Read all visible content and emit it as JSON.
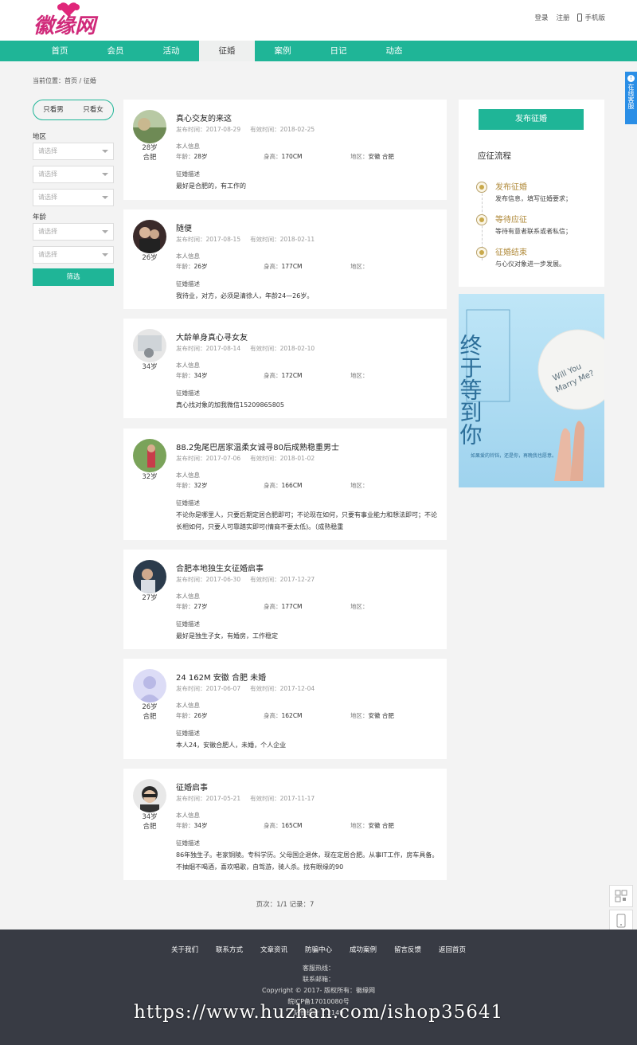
{
  "header": {
    "logo_text": "徽缘网",
    "login": "登录",
    "register": "注册",
    "mobile": "手机版"
  },
  "nav": [
    {
      "label": "首页"
    },
    {
      "label": "会员"
    },
    {
      "label": "活动"
    },
    {
      "label": "征婚",
      "active": true
    },
    {
      "label": "案例"
    },
    {
      "label": "日记"
    },
    {
      "label": "动态"
    }
  ],
  "breadcrumb": "当前位置：首页 / 征婚",
  "sidebar": {
    "only_male": "只看男",
    "only_female": "只看女",
    "region_label": "地区",
    "age_label": "年龄",
    "placeholder": "请选择",
    "filter_button": "筛选"
  },
  "posts_labels": {
    "publish_time": "发布时间：",
    "valid_time": "有效时间：",
    "personal_info": "本人信息",
    "age": "年龄：",
    "height": "身高：",
    "region": "地区：",
    "desc_title": "征婚描述"
  },
  "posts": [
    {
      "title": "真心交友的来这",
      "pub": "2017-08-29",
      "valid": "2018-02-25",
      "age_short": "28岁",
      "city": "合肥",
      "age": "28岁",
      "height": "170CM",
      "region": "安徽 合肥",
      "desc": "最好是合肥的，有工作的"
    },
    {
      "title": "随便",
      "pub": "2017-08-15",
      "valid": "2018-02-11",
      "age_short": "26岁",
      "city": "",
      "age": "26岁",
      "height": "177CM",
      "region": "",
      "desc": "我待业，对方，必须是清徐人，年龄24—26岁。"
    },
    {
      "title": "大龄单身真心寻女友",
      "pub": "2017-08-14",
      "valid": "2018-02-10",
      "age_short": "34岁",
      "city": "",
      "age": "34岁",
      "height": "172CM",
      "region": "",
      "desc": "真心找对象的加我微信15209865805"
    },
    {
      "title": "88.2兔尾巴居家温柔女诚寻80后成熟稳重男士",
      "pub": "2017-07-06",
      "valid": "2018-01-02",
      "age_short": "32岁",
      "city": "",
      "age": "32岁",
      "height": "166CM",
      "region": "",
      "desc": "不论你是哪里人，只要后期定居合肥即可；不论现在如何，只要有事业能力和想法即可；不论长相如何，只要人可靠踏实即可(情商不要太低)。（成熟稳重"
    },
    {
      "title": "合肥本地独生女征婚启事",
      "pub": "2017-06-30",
      "valid": "2017-12-27",
      "age_short": "27岁",
      "city": "",
      "age": "27岁",
      "height": "177CM",
      "region": "",
      "desc": "最好是独生子女，有婚房，工作稳定"
    },
    {
      "title": "24 162M 安徽 合肥 未婚",
      "pub": "2017-06-07",
      "valid": "2017-12-04",
      "age_short": "26岁",
      "city": "合肥",
      "age": "26岁",
      "height": "162CM",
      "region": "安徽 合肥",
      "desc": "本人24，安徽合肥人，未婚，个人企业"
    },
    {
      "title": "征婚启事",
      "pub": "2017-05-21",
      "valid": "2017-11-17",
      "age_short": "34岁",
      "city": "合肥",
      "age": "34岁",
      "height": "165CM",
      "region": "安徽 合肥",
      "desc": "86年独生子。老家铜陵。专科学历。父母国企退休，现在定居合肥。从事IT工作，房车具备。不抽烟不喝酒，喜欢唱歌，自驾游，骑人杀。找有眼缘的90"
    }
  ],
  "pager": "页次：1/1  记录：7",
  "right_panel": {
    "publish_button": "发布征婚",
    "flow_title": "应征流程",
    "steps": [
      {
        "title": "发布征婚",
        "desc": "发布信息，填写征婚要求；"
      },
      {
        "title": "等待应征",
        "desc": "等待有意者联系或者私信；"
      },
      {
        "title": "征婚结束",
        "desc": "与心仪对象进一步发展。"
      }
    ]
  },
  "banner": {
    "big_text": "终于等到你",
    "balloon_line1": "Will You",
    "balloon_line2": "Marry Me?",
    "small_text": "如果爱的铃铛，还是你，再晚我也愿意。"
  },
  "side_tab": "在线客服",
  "footer": {
    "links": [
      "关于我们",
      "联系方式",
      "文章资讯",
      "防骗中心",
      "成功案例",
      "留言反馈",
      "返回首页"
    ],
    "hotline": "客服热线：",
    "email": "联系邮箱：",
    "copyright": "Copyright © 2017-  版权所有：徽缘网",
    "icp": "皖ICP备17010080号",
    "stats": "站长统计  1  2149"
  },
  "watermark": "https://www.huzhan.com/ishop35641",
  "colors": {
    "primary": "#1fb597",
    "footer_bg": "#383b44",
    "accent_gold": "#b08a3a"
  }
}
